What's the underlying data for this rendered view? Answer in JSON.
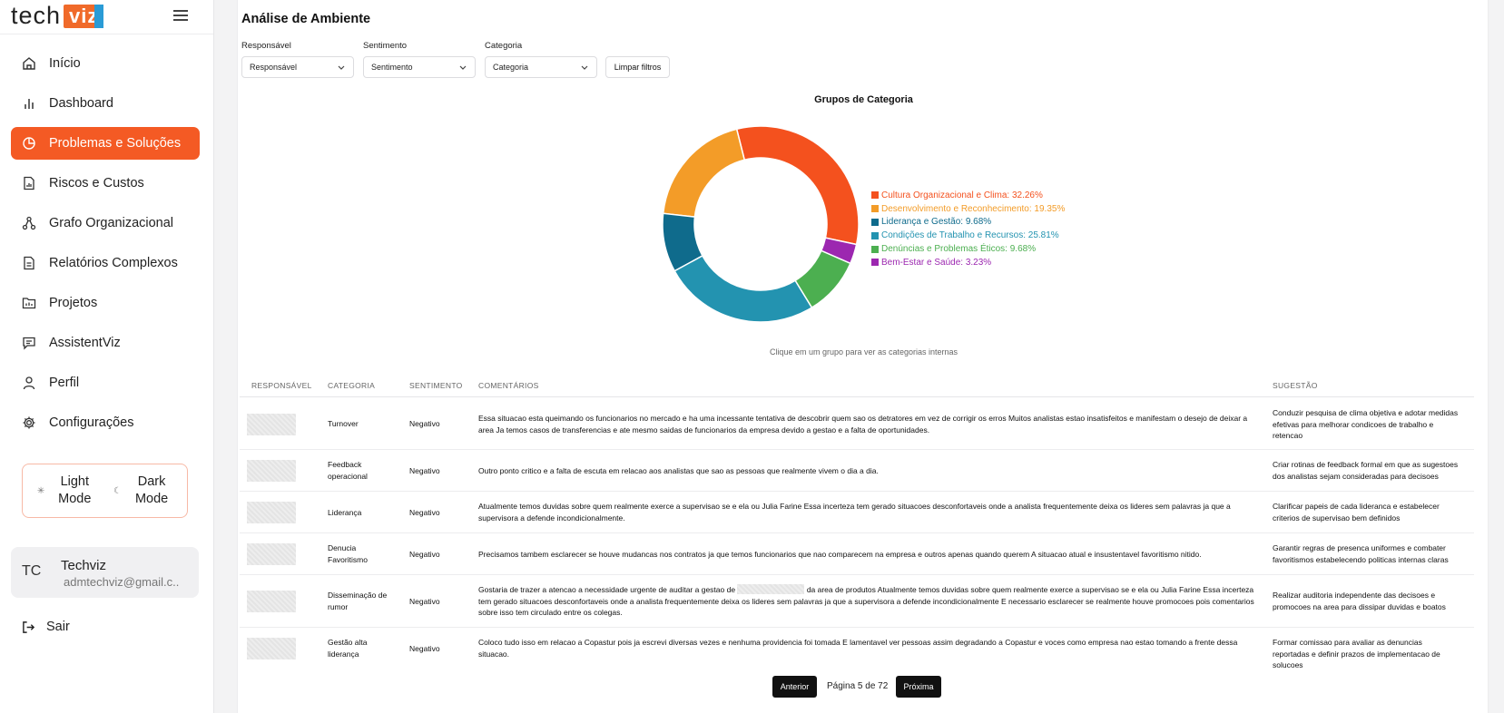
{
  "brand": {
    "part1": "tech",
    "part2": "viz"
  },
  "sidebar": {
    "items": [
      {
        "label": "Início",
        "icon": "home-icon"
      },
      {
        "label": "Dashboard",
        "icon": "bar-chart-icon"
      },
      {
        "label": "Problemas e Soluções",
        "icon": "pie-chart-icon",
        "active": true
      },
      {
        "label": "Riscos e Custos",
        "icon": "report-icon"
      },
      {
        "label": "Grafo Organizacional",
        "icon": "org-graph-icon"
      },
      {
        "label": "Relatórios Complexos",
        "icon": "document-icon"
      },
      {
        "label": "Projetos",
        "icon": "folder-icon"
      },
      {
        "label": "AssistentViz",
        "icon": "chat-icon"
      },
      {
        "label": "Perfil",
        "icon": "user-icon"
      },
      {
        "label": "Configurações",
        "icon": "gear-icon"
      }
    ],
    "light_mode": "Light Mode",
    "dark_mode": "Dark Mode",
    "user": {
      "initials": "TC",
      "name": "Techviz",
      "email": "admtechviz@gmail.c.."
    },
    "logout": "Sair"
  },
  "main": {
    "title": "Análise de Ambiente",
    "filters": {
      "responsavel": {
        "label": "Responsável",
        "value": "Responsável"
      },
      "sentimento": {
        "label": "Sentimento",
        "value": "Sentimento"
      },
      "categoria": {
        "label": "Categoria",
        "value": "Categoria"
      },
      "clear": "Limpar filtros"
    },
    "chart_hint": "Clique em um grupo para ver as categorias internas",
    "table": {
      "headers": {
        "responsavel": "RESPONSÁVEL",
        "categoria": "CATEGORIA",
        "sentimento": "SENTIMENTO",
        "comentarios": "COMENTÁRIOS",
        "sugestao": "SUGESTÃO"
      },
      "rows": [
        {
          "categoria": "Turnover",
          "sentimento": "Negativo",
          "comentario": "Essa situacao esta queimando os funcionarios no mercado e ha uma incessante tentativa de descobrir quem sao os detratores em vez de corrigir os erros Muitos analistas estao insatisfeitos e manifestam o desejo de deixar a area Ja temos casos de transferencias e ate mesmo saidas de funcionarios da empresa devido a gestao e a falta de oportunidades.",
          "sugestao": "Conduzir pesquisa de clima objetiva e adotar medidas efetivas para melhorar condicoes de trabalho e retencao"
        },
        {
          "categoria": "Feedback operacional",
          "sentimento": "Negativo",
          "comentario": "Outro ponto critico e a falta de escuta em relacao aos analistas que sao as pessoas que realmente vivem o dia a dia.",
          "sugestao": "Criar rotinas de feedback formal em que as sugestoes dos analistas sejam consideradas para decisoes"
        },
        {
          "categoria": "Liderança",
          "sentimento": "Negativo",
          "comentario": "Atualmente temos duvidas sobre quem realmente exerce a supervisao se e ela ou Julia Farine Essa incerteza tem gerado situacoes desconfortaveis onde a analista frequentemente deixa os lideres sem palavras ja que a supervisora a defende incondicionalmente.",
          "sugestao": "Clarificar papeis de cada lideranca e estabelecer criterios de supervisao bem definidos"
        },
        {
          "categoria": "Denucia Favoritismo",
          "sentimento": "Negativo",
          "comentario": "Precisamos tambem esclarecer se houve mudancas nos contratos ja que temos funcionarios que nao comparecem na empresa e outros apenas quando querem A situacao atual e insustentavel favoritismo nitido.",
          "sugestao": "Garantir regras de presenca uniformes e combater favoritismos estabelecendo politicas internas claras"
        },
        {
          "categoria": "Disseminação de rumor",
          "sentimento": "Negativo",
          "comentario_a": "Gostaria de trazer a atencao a necessidade urgente de auditar a gestao de",
          "comentario_b": "da area de produtos Atualmente temos duvidas sobre quem realmente exerce a supervisao se e ela ou Julia Farine Essa incerteza tem gerado situacoes desconfortaveis onde a analista frequentemente deixa os lideres sem palavras ja que a supervisora a defende incondicionalmente E necessario esclarecer se realmente houve promocoes pois comentarios sobre isso tem circulado entre os colegas.",
          "sugestao": "Realizar auditoria independente das decisoes e promocoes na area para dissipar duvidas e boatos"
        },
        {
          "categoria": "Gestão alta liderança",
          "sentimento": "Negativo",
          "comentario": "Coloco tudo isso em relacao a Copastur pois ja escrevi diversas vezes e nenhuma providencia foi tomada E lamentavel ver pessoas assim degradando a Copastur e voces como empresa nao estao tomando a frente dessa situacao.",
          "sugestao": "Formar comissao para avaliar as denuncias reportadas e definir prazos de implementacao de solucoes"
        }
      ]
    },
    "pagination": {
      "prev": "Anterior",
      "page_text": "Página 5 de 72",
      "next": "Próxima"
    }
  },
  "chart_data": {
    "type": "pie",
    "title": "Grupos de Categoria",
    "donut": true,
    "legend_position": "right",
    "series": [
      {
        "name": "Cultura Organizacional e Clima",
        "value": 32.26,
        "label": "Cultura Organizacional e Clima: 32.26%",
        "color": "#f4511e"
      },
      {
        "name": "Desenvolvimento e Reconhecimento",
        "value": 19.35,
        "label": "Desenvolvimento e Reconhecimento: 19.35%",
        "color": "#f39c28"
      },
      {
        "name": "Liderança e Gestão",
        "value": 9.68,
        "label": "Liderança e Gestão: 9.68%",
        "color": "#0f6b8c"
      },
      {
        "name": "Condições de Trabalho e Recursos",
        "value": 25.81,
        "label": "Condições de Trabalho e Recursos: 25.81%",
        "color": "#2393b0"
      },
      {
        "name": "Denúncias e Problemas Éticos",
        "value": 9.68,
        "label": "Denúncias e Problemas Éticos: 9.68%",
        "color": "#4caf50"
      },
      {
        "name": "Bem-Estar e Saúde",
        "value": 3.23,
        "label": "Bem-Estar e Saúde: 3.23%",
        "color": "#9c27b0"
      }
    ]
  }
}
